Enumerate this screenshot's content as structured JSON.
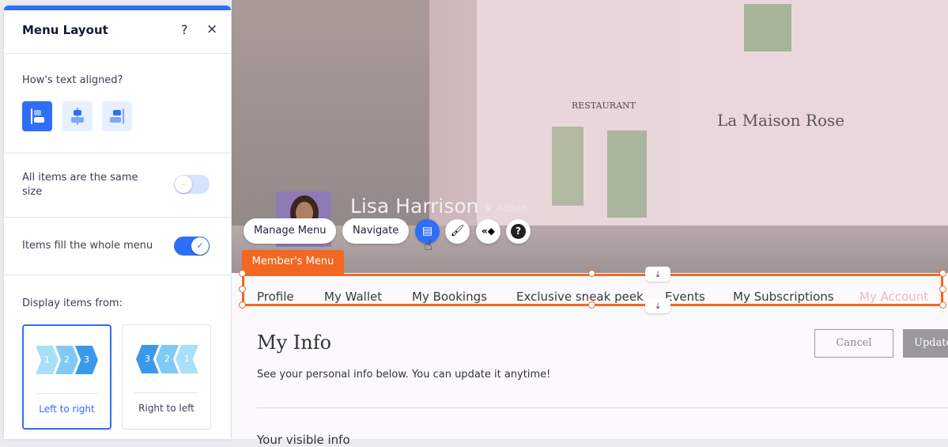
{
  "panel": {
    "title": "Menu Layout",
    "help_icon": "?",
    "close_icon": "×",
    "text_align": {
      "label": "How's text aligned?",
      "options": [
        "left",
        "center",
        "right"
      ],
      "selected": "left"
    },
    "same_size": {
      "label": "All items are the same size",
      "on": false
    },
    "fill_menu": {
      "label": "Items fill the whole menu",
      "on": true
    },
    "display_from": {
      "label": "Display items from:",
      "options": [
        {
          "label": "Left to right",
          "numbers": [
            "1",
            "2",
            "3"
          ],
          "selected": true
        },
        {
          "label": "Right to left",
          "numbers": [
            "3",
            "2",
            "1"
          ],
          "selected": false
        }
      ]
    }
  },
  "site": {
    "member_name": "Lisa Harrison",
    "role": "Admin",
    "toolbar": {
      "manage_menu": "Manage Menu",
      "navigate": "Navigate",
      "icons": [
        "layout-icon",
        "design-brush-icon",
        "animation-icon",
        "help-icon"
      ]
    },
    "menu_tag": "Member's Menu",
    "menu_items": [
      "Profile",
      "My Wallet",
      "My Bookings",
      "Exclusive sneak peek",
      "Events",
      "My Subscriptions",
      "My Account"
    ],
    "page_title": "My Info",
    "subtitle": "See your personal info below. You can update it anytime!",
    "cancel": "Cancel",
    "update": "Update",
    "section_heading": "Your visible info",
    "hero_signs": {
      "restaurant": "RESTAURANT",
      "shop": "La Maison Rose"
    }
  },
  "colors": {
    "accent": "#2f6ef6",
    "selection": "#f26722",
    "active_item": "#e3bcc8"
  }
}
